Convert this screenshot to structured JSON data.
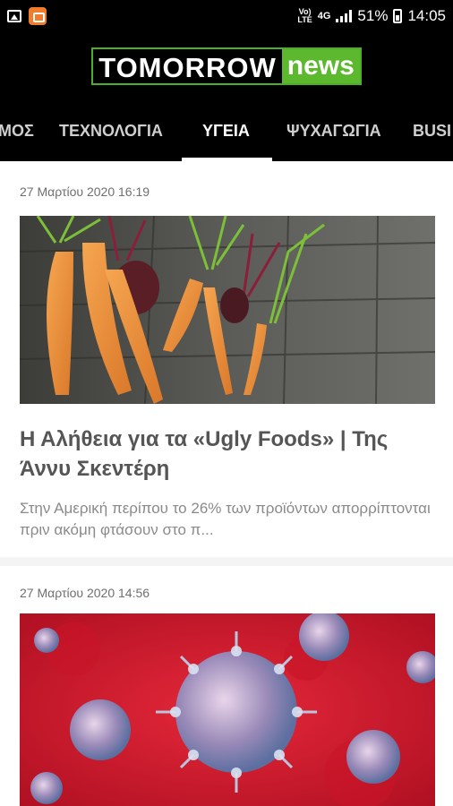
{
  "status_bar": {
    "volte_line1": "Vo)",
    "volte_line2": "LTE",
    "network": "4G",
    "battery_percent": "51%",
    "time": "14:05"
  },
  "header": {
    "logo_main": "TOMORROW",
    "logo_sub": "news",
    "brand_color": "#5cb82c"
  },
  "tabs": [
    {
      "label": "ΜΟΣ"
    },
    {
      "label": "ΤΕΧΝΟΛΟΓΙΑ"
    },
    {
      "label": "ΥΓΕΙΑ",
      "active": true
    },
    {
      "label": "ΨΥΧΑΓΩΓΙΑ"
    },
    {
      "label": "BUSI"
    }
  ],
  "articles": [
    {
      "date": "27 Μαρτίου 2020 16:19",
      "image": "carrots-and-beets-photo",
      "title": "Η Αλήθεια για τα «Ugly Foods» | Της Άννυ Σκεντέρη",
      "excerpt": "Στην Αμερική περίπου το 26% των προϊόντων απορρίπτονται πριν ακόμη φτάσουν στο π..."
    },
    {
      "date": "27 Μαρτίου 2020 14:56",
      "image": "coronavirus-illustration"
    }
  ]
}
